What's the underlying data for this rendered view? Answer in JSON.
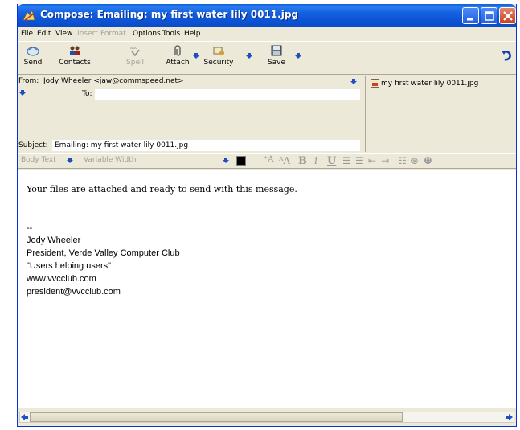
{
  "window": {
    "title": "Compose: Emailing: my first water lily 0011.jpg"
  },
  "menu": {
    "file": "File",
    "edit": "Edit",
    "view": "View",
    "insert": "Insert",
    "format": "Format",
    "options": "Options",
    "tools": "Tools",
    "help": "Help"
  },
  "toolbar": {
    "send": "Send",
    "contacts": "Contacts",
    "spell": "Spell",
    "attach": "Attach",
    "security": "Security",
    "save": "Save"
  },
  "header": {
    "from_label": "From:",
    "from_value": "Jody Wheeler <jaw@commspeed.net>",
    "to_label": "To:",
    "to_value": "",
    "subject_label": "Subject:",
    "subject_value": "Emailing: my first water lily 0011.jpg"
  },
  "attachments": [
    {
      "name": "my first water lily 0011.jpg"
    }
  ],
  "format_bar": {
    "paragraph_style": "Body Text",
    "font": "Variable Width",
    "text_color": "#000000",
    "bg_color": "#ffffff"
  },
  "body": {
    "intro": "Your files are attached and ready to send with this message.",
    "sig_sep": "--",
    "sig_name": "Jody Wheeler",
    "sig_title": "President, Verde Valley Computer Club",
    "sig_motto": "\"Users helping users\"",
    "sig_url": "www.vvcclub.com",
    "sig_email": "president@vvcclub.com"
  }
}
